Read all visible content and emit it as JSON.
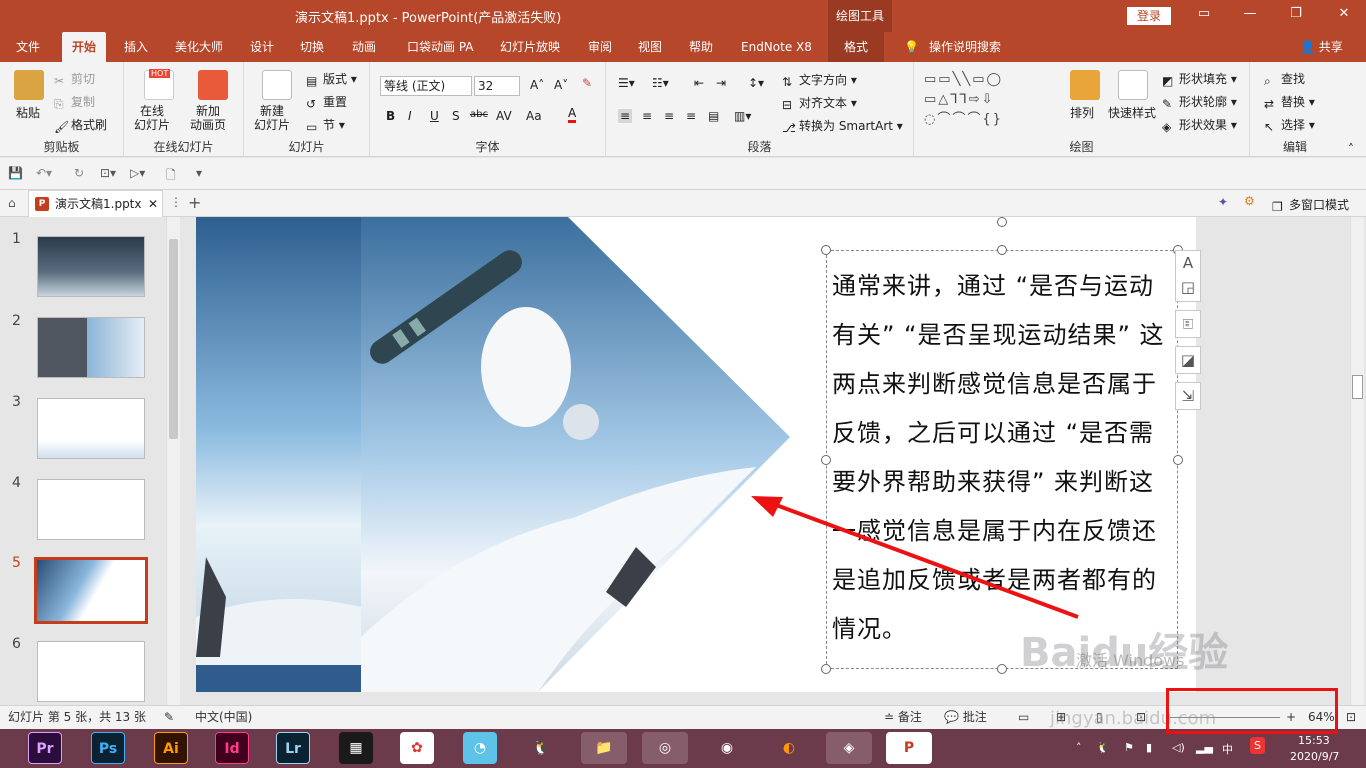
{
  "titlebar": {
    "title": "演示文稿1.pptx  -  PowerPoint(产品激活失败)",
    "context": "绘图工具",
    "login": "登录",
    "buttons": [
      "▭",
      "—",
      "❐",
      "✕"
    ]
  },
  "tabs": [
    "文件",
    "开始",
    "插入",
    "美化大师",
    "设计",
    "切换",
    "动画",
    "口袋动画 PA",
    "幻灯片放映",
    "审阅",
    "视图",
    "帮助",
    "EndNote X8",
    "格式",
    "操作说明搜索",
    "共享"
  ],
  "ribbon": {
    "clipboard": {
      "paste": "粘贴",
      "cut": "剪切",
      "copy": "复制",
      "format_painter": "格式刷",
      "label": "剪贴板"
    },
    "online": {
      "online_slide": "在线\n幻灯片",
      "new_anim": "新加\n动画页",
      "label": "在线幻灯片",
      "hot": "HOT"
    },
    "slides": {
      "new_slide": "新建\n幻灯片",
      "layout": "版式",
      "reset": "重置",
      "section": "节",
      "label": "幻灯片"
    },
    "font": {
      "name": "等线 (正文)",
      "size": "32",
      "label": "字体",
      "bold": "B",
      "italic": "I",
      "underline": "U",
      "shadow": "S",
      "strike": "abc",
      "spacing": "AV",
      "case": "Aa",
      "color": "A",
      "grow": "A˄",
      "shrink": "A˅"
    },
    "paragraph": {
      "text_dir": "文字方向",
      "align_text": "对齐文本",
      "smartart": "转换为 SmartArt",
      "label": "段落"
    },
    "drawing": {
      "arrange": "排列",
      "quick_styles": "快速样式",
      "fill": "形状填充",
      "outline": "形状轮廓",
      "effects": "形状效果",
      "label": "绘图"
    },
    "editing": {
      "find": "查找",
      "replace": "替换",
      "select": "选择",
      "label": "编辑"
    }
  },
  "doc_tab": {
    "name": "演示文稿1.pptx",
    "icon": "P",
    "close": "✕",
    "multi_window": "多窗口模式"
  },
  "thumbnails": [
    {
      "num": "1"
    },
    {
      "num": "2"
    },
    {
      "num": "3"
    },
    {
      "num": "4"
    },
    {
      "num": "5",
      "current": true
    },
    {
      "num": "6"
    }
  ],
  "slide": {
    "body": "通常来讲，通过 “是否与运动有关” “是否呈现运动结果” 这两点来判断感觉信息是否属于反馈，之后可以通过 “是否需要外界帮助来获得” 来判断这一感觉信息是属于内在反馈还是追加反馈或者是两者都有的情况。",
    "activate_watermark": "激活 Windows"
  },
  "statusbar": {
    "slide_info": "幻灯片 第 5 张，共 13 张",
    "language": "中文(中国)",
    "notes": "备注",
    "comments": "批注",
    "zoom": "64%"
  },
  "taskbar": {
    "apps": [
      "Pr",
      "Ps",
      "Ai",
      "Id",
      "Lr",
      "▦",
      "✿",
      "◔",
      "🐧",
      "📁",
      "◎",
      "◉",
      "◐",
      "◈",
      "P"
    ],
    "time": "15:53",
    "date": "2020/9/7",
    "ime": "中"
  },
  "watermark": "Baidu经验",
  "watermark_url": "jingyan.baidu.com",
  "colors": {
    "brand": "#b7472a",
    "accent_red": "#e11111",
    "taskbar": "#6b3a4b"
  }
}
